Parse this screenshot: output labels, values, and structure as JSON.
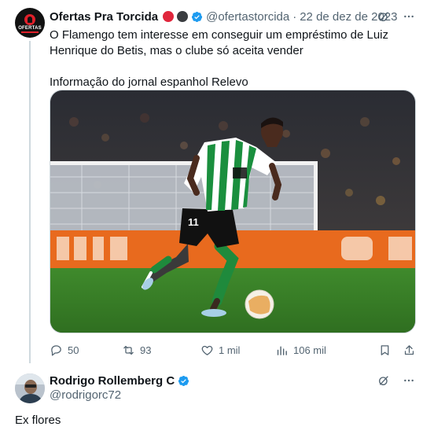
{
  "tweet": {
    "author_name": "Ofertas Pra Torcida",
    "avatar_text": "OFERTAS",
    "handle": "@ofertastorcida",
    "separator": "·",
    "date": "22 de dez de 2023",
    "text_line1": "O Flamengo tem interesse em conseguir um empréstimo de Luiz Henrique do Betis, mas o clube só aceita vender",
    "text_line2": "Informação do jornal espanhol Relevo",
    "player_number": "11",
    "metrics": {
      "replies": "50",
      "reposts": "93",
      "likes": "1 mil",
      "views": "106 mil"
    }
  },
  "reply": {
    "author_name": "Rodrigo Rollemberg C",
    "handle": "@rodrigorc72",
    "text": "Ex flores"
  },
  "colors": {
    "text_primary": "#0f1419",
    "text_secondary": "#536471",
    "verified_blue": "#1d9bf0",
    "badge_red": "#e0263c",
    "badge_black": "#3a3d40"
  },
  "icons": [
    "grok-icon",
    "more-icon",
    "reply-icon",
    "repost-icon",
    "like-icon",
    "views-icon",
    "bookmark-icon",
    "share-icon",
    "verified-icon"
  ]
}
